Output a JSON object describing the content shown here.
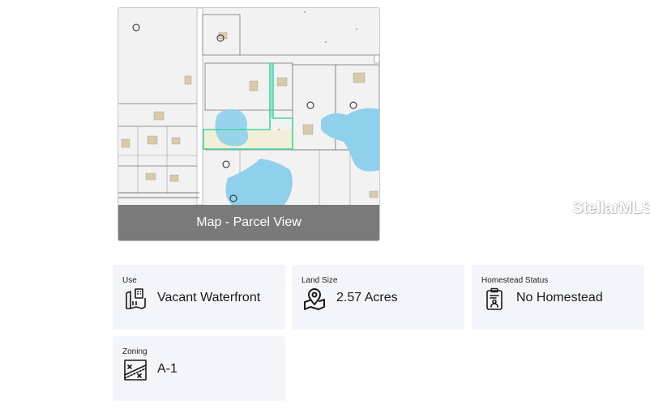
{
  "map": {
    "caption": "Map - Parcel View"
  },
  "watermark": "StellarMLS",
  "tiles": [
    {
      "label": "Use",
      "value": "Vacant Waterfront",
      "icon": "building-map-icon"
    },
    {
      "label": "Land Size",
      "value": "2.57 Acres",
      "icon": "map-pin-icon"
    },
    {
      "label": "Homestead Status",
      "value": "No Homestead",
      "icon": "clipboard-person-icon"
    },
    {
      "label": "Zoning",
      "value": "A-1",
      "icon": "zoning-map-icon"
    }
  ],
  "colors": {
    "tile_bg": "#f4f5fb",
    "caption_bg": "#7a7a7a",
    "water": "#8fd0ec",
    "parcel_outline": "#3fd6a8"
  }
}
